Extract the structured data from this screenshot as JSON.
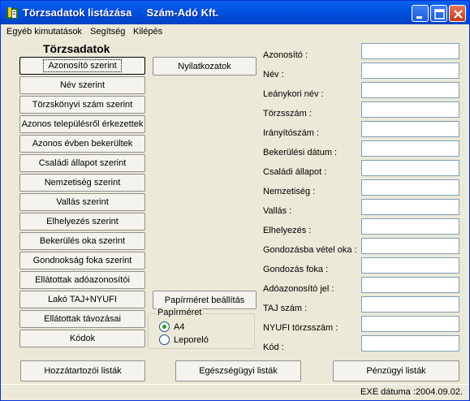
{
  "titlebar": {
    "title": "Törzsadatok listázása     Szám-Adó Kft."
  },
  "menu": {
    "items": [
      "Egyéb kimutatások",
      "Segítség",
      "Kilépés"
    ]
  },
  "panel": {
    "title": "Törzsadatok"
  },
  "sidebar": {
    "buttons": [
      "Azonosító szerint",
      "Név szerint",
      "Törzskönyvi szám szerint",
      "Azonos településről érkezettek",
      "Azonos évben bekerültek",
      "Családi állapot szerint",
      "Nemzetiség szerint",
      "Vallás szerint",
      "Elhelyezés szerint",
      "Bekerülés oka szerint",
      "Gondnokság foka szerint",
      "Ellátottak adóazonosítói",
      "Lakó TAJ+NYUFI",
      "Ellátottak távozásai",
      "Kódok"
    ]
  },
  "middle": {
    "declarations_label": "Nyilatkozatok",
    "paper_settings_label": "Papírméret beállítás",
    "paper_size": {
      "legend": "Papírméret",
      "options": [
        "A4",
        "Leporeló"
      ],
      "selected": "A4"
    }
  },
  "fields": [
    {
      "label": "Azonosító :",
      "value": ""
    },
    {
      "label": "Név :",
      "value": ""
    },
    {
      "label": "Leánykori név :",
      "value": ""
    },
    {
      "label": "Törzsszám :",
      "value": ""
    },
    {
      "label": "Irányítószám :",
      "value": ""
    },
    {
      "label": "Bekerülési dátum :",
      "value": ""
    },
    {
      "label": "Családi állapot :",
      "value": ""
    },
    {
      "label": "Nemzetiség :",
      "value": ""
    },
    {
      "label": "Vallás :",
      "value": ""
    },
    {
      "label": "Elhelyezés :",
      "value": ""
    },
    {
      "label": "Gondozásba vétel oka :",
      "value": ""
    },
    {
      "label": "Gondozás foka :",
      "value": ""
    },
    {
      "label": "Adóazonosító jel :",
      "value": ""
    },
    {
      "label": "TAJ szám :",
      "value": ""
    },
    {
      "label": "NYUFI törzsszám :",
      "value": ""
    },
    {
      "label": "Kód :",
      "value": ""
    }
  ],
  "bottom": {
    "relatives_label": "Hozzátartozói listák",
    "health_label": "Egészségügyi listák",
    "financial_label": "Pénzügyi listák"
  },
  "status": {
    "text": "EXE dátuma :2004.09.02."
  },
  "colors": {
    "titlebar": "#0054E3",
    "close_button": "#C43A1C",
    "window_bg": "#ECE9D8",
    "radio_dot": "#21A121"
  }
}
